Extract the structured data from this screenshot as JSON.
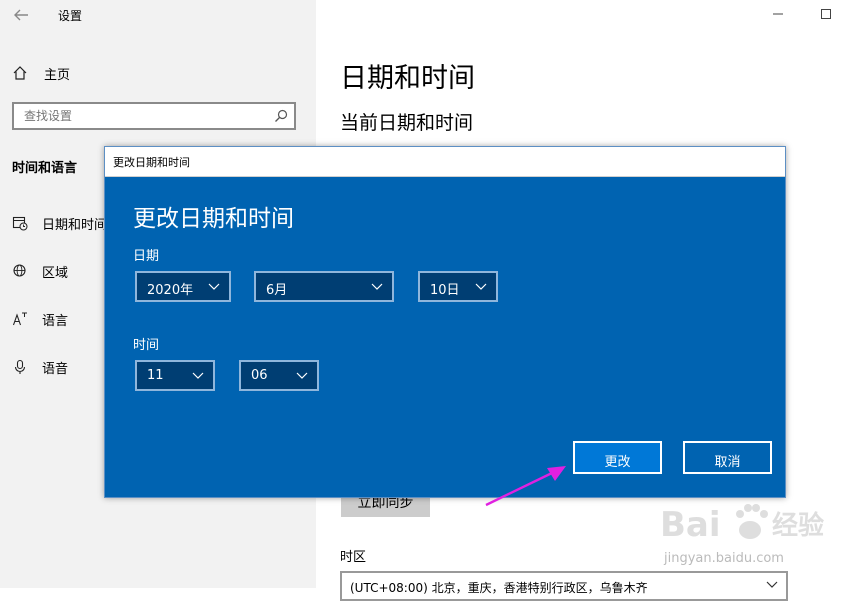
{
  "window": {
    "title": "设置"
  },
  "sidebar": {
    "home_label": "主页",
    "search_placeholder": "查找设置",
    "section_title": "时间和语言",
    "items": [
      {
        "label": "日期和时间"
      },
      {
        "label": "区域"
      },
      {
        "label": "语言"
      },
      {
        "label": "语音"
      }
    ]
  },
  "main": {
    "page_title": "日期和时间",
    "sub_title": "当前日期和时间",
    "sync_button": "立即同步",
    "timezone_label": "时区",
    "timezone_value": "(UTC+08:00) 北京，重庆，香港特别行政区，乌鲁木齐"
  },
  "dialog": {
    "window_title": "更改日期和时间",
    "heading": "更改日期和时间",
    "date_label": "日期",
    "year": "2020年",
    "month": "6月",
    "day": "10日",
    "time_label": "时间",
    "hour": "11",
    "minute": "06",
    "change_button": "更改",
    "cancel_button": "取消"
  },
  "watermark": {
    "brand": "Baidu经验",
    "url": "jingyan.baidu.com"
  },
  "colors": {
    "dialog_bg": "#0063b1",
    "dropdown_bg": "#003e73",
    "primary_button": "#0078d7",
    "sidebar_bg": "#f2f2f2",
    "annotation_arrow": "#e020e0"
  }
}
